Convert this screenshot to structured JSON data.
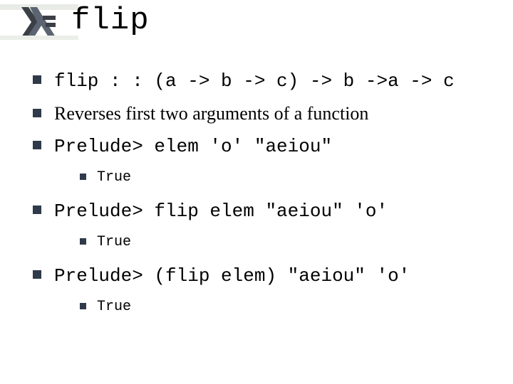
{
  "title": "flip",
  "bullets": {
    "b1": "flip : : (a -> b -> c) -> b ->a -> c",
    "b2": "Reverses first two arguments of a function",
    "b3": "Prelude> elem 'o' \"aeiou\"",
    "b3_sub": "True",
    "b4": "Prelude> flip elem \"aeiou\" 'o'",
    "b4_sub": "True",
    "b5": "Prelude> (flip elem) \"aeiou\" 'o'",
    "b5_sub": "True"
  }
}
